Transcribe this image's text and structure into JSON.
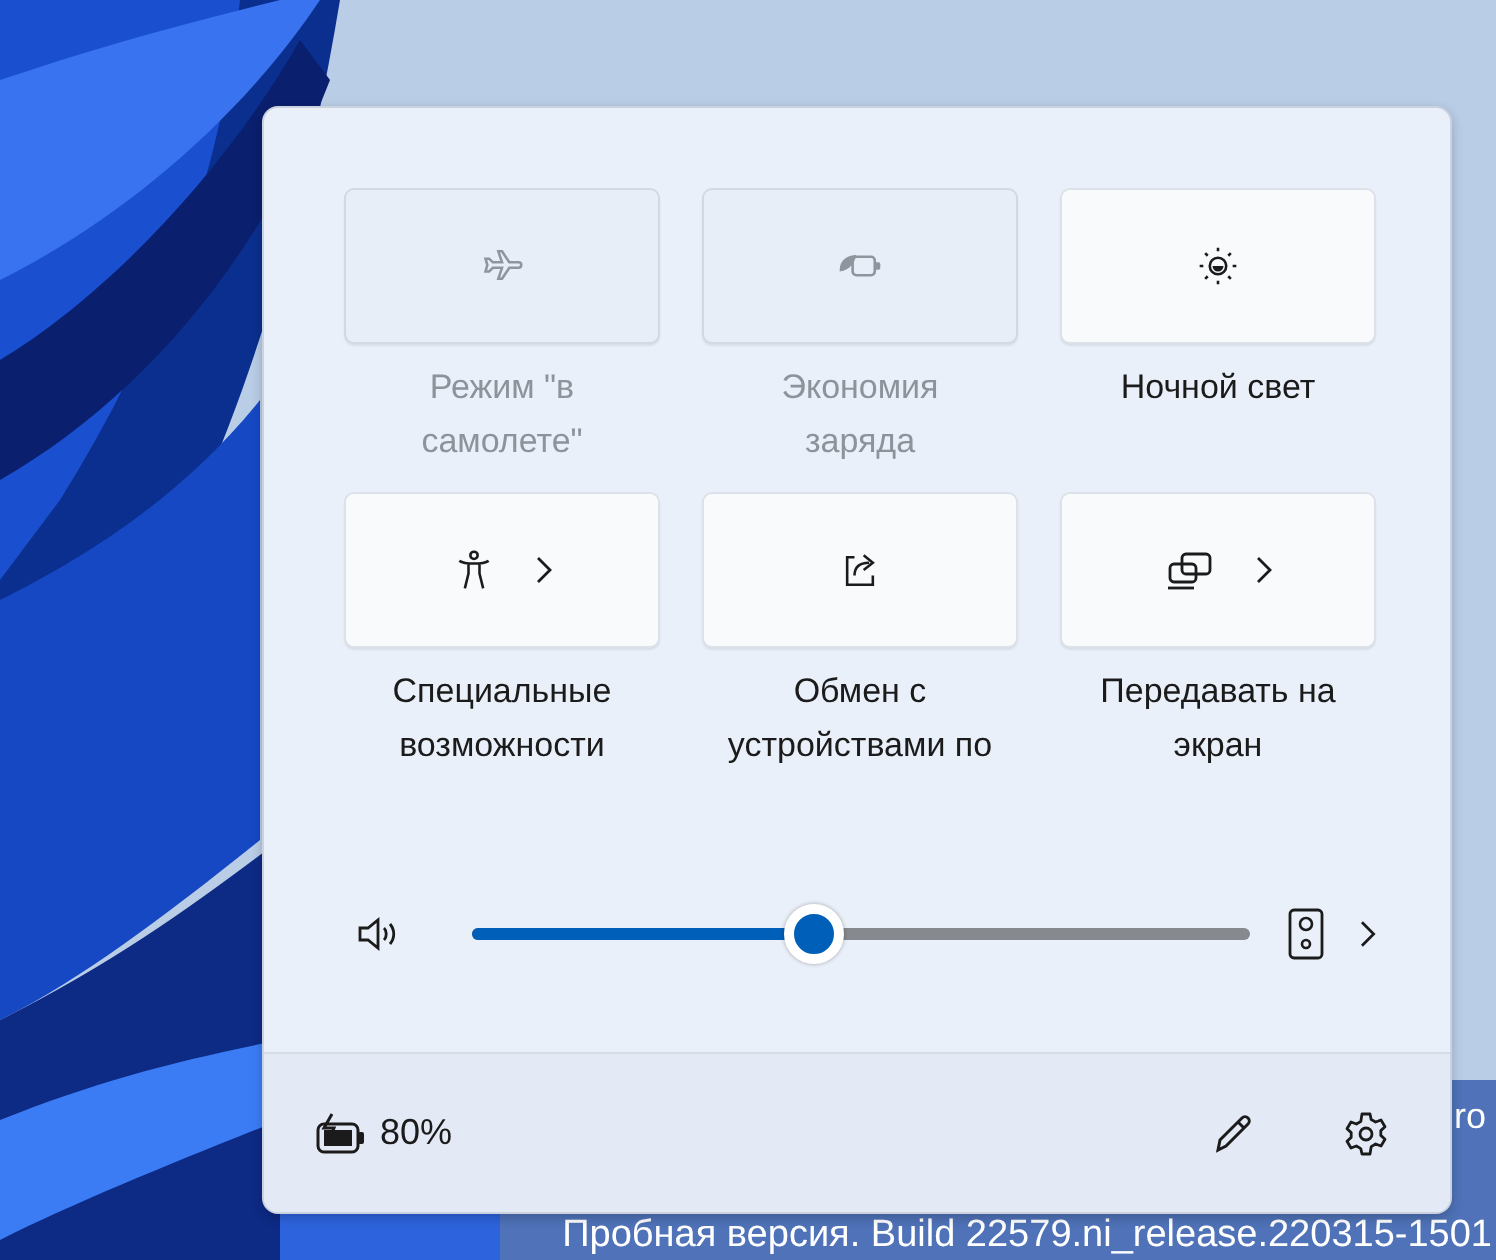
{
  "desktop": {
    "edition_fragment": "ro",
    "watermark": "Пробная версия. Build 22579.ni_release.220315-1501"
  },
  "quick_settings": {
    "tiles": [
      {
        "kind": "airplane",
        "label": "Режим \"в самолете\"",
        "disabled": true,
        "on": false,
        "expandable": false
      },
      {
        "kind": "battery-saver",
        "label": "Экономия заряда",
        "disabled": true,
        "on": false,
        "expandable": false
      },
      {
        "kind": "night-light",
        "label": "Ночной свет",
        "disabled": false,
        "on": false,
        "expandable": false
      },
      {
        "kind": "accessibility",
        "label": "Специальные возможности",
        "disabled": false,
        "on": false,
        "expandable": true
      },
      {
        "kind": "share",
        "label": "Обмен с устройствами по",
        "disabled": false,
        "on": false,
        "expandable": false
      },
      {
        "kind": "cast",
        "label": "Передавать на экран",
        "disabled": false,
        "on": false,
        "expandable": true
      }
    ],
    "volume": {
      "level": 0.44
    },
    "footer": {
      "battery": "80%"
    }
  }
}
